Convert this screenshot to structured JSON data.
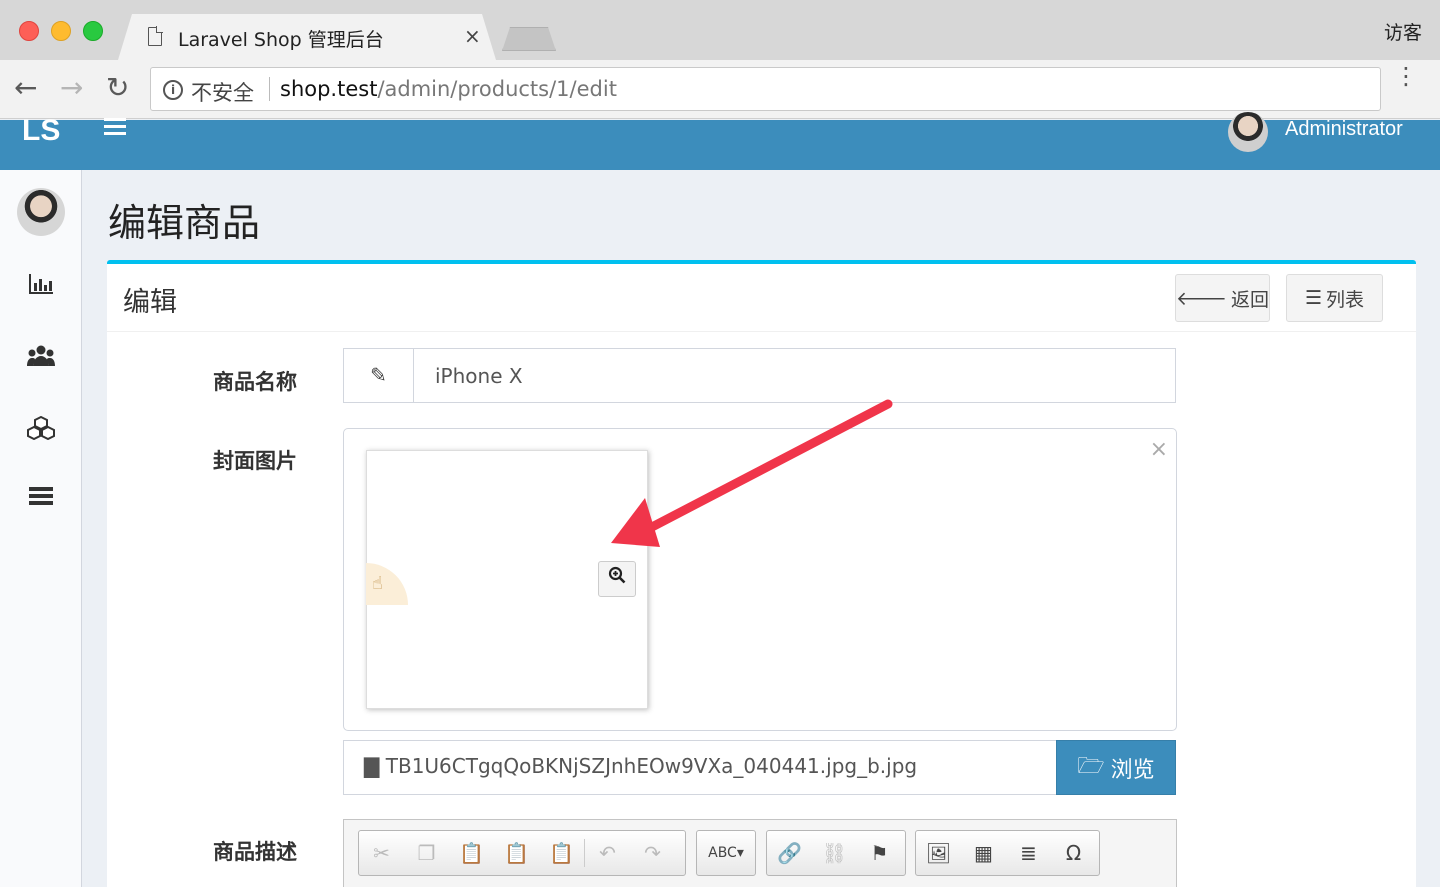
{
  "browser": {
    "tab_title": "Laravel Shop 管理后台",
    "tab_close": "×",
    "guest_label": "访客",
    "insecure_label": "不安全",
    "url_host": "shop.test",
    "url_path": "/admin/products/1/edit"
  },
  "header": {
    "logo": "LS",
    "user_name": "Administrator"
  },
  "sidebar": {
    "items": [
      {
        "icon": "bar-chart-icon"
      },
      {
        "icon": "users-icon"
      },
      {
        "icon": "cubes-icon"
      },
      {
        "icon": "list-icon"
      }
    ]
  },
  "page": {
    "title": "编辑商品"
  },
  "box": {
    "title": "编辑",
    "back_label": "返回",
    "list_label": "列表"
  },
  "form": {
    "name_label": "商品名称",
    "name_value": "iPhone X",
    "cover_label": "封面图片",
    "file_caption": "TB1U6CTgqQoBKNjSZJnhEOw9VXa_040441.jpg_b.jpg",
    "browse_label": "浏览",
    "desc_label": "商品描述"
  },
  "colors": {
    "header": "#3c8dbc",
    "box_border": "#00c0ef",
    "annotation_arrow": "#f0354a"
  }
}
